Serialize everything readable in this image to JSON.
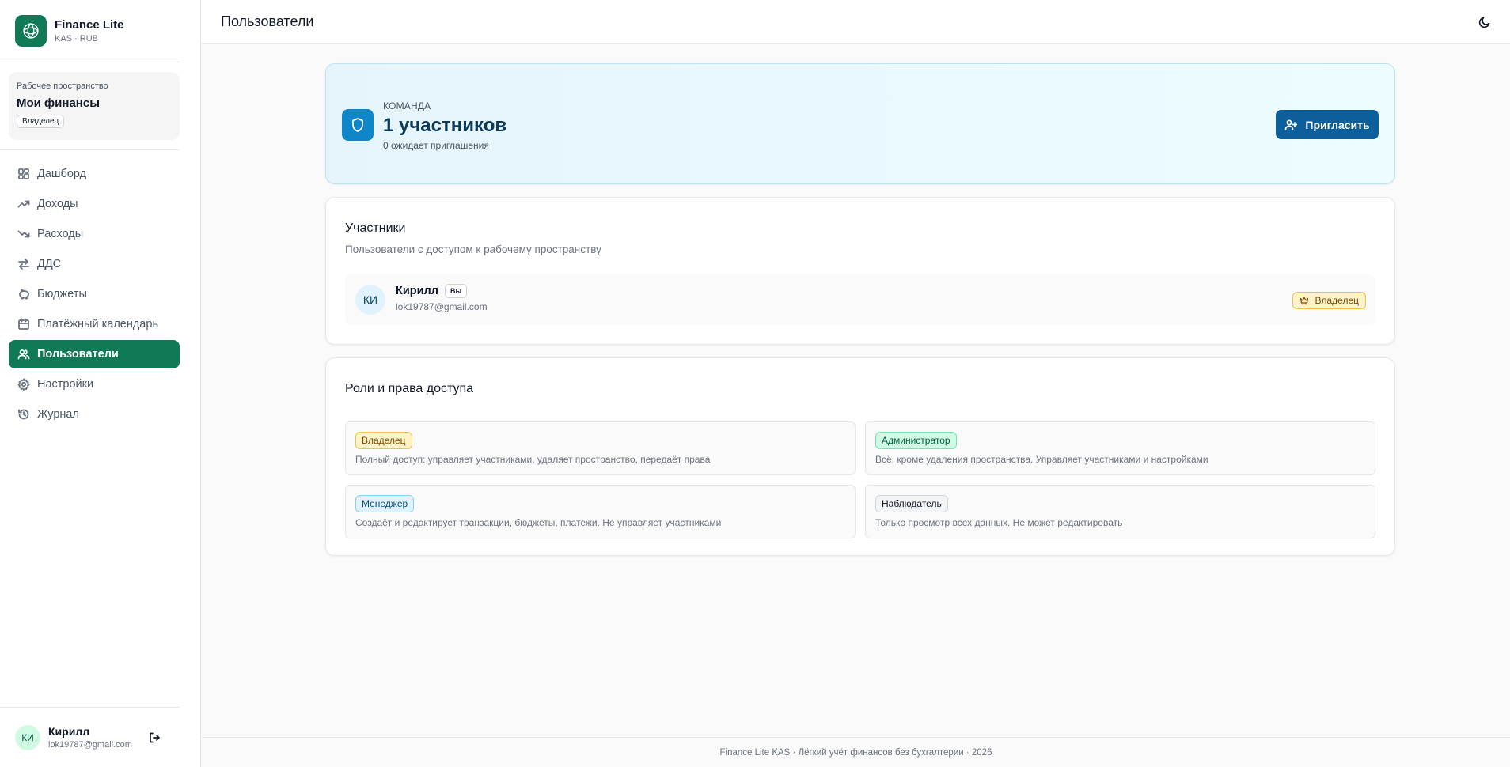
{
  "brand": {
    "name": "Finance Lite",
    "subtitle": "KAS · RUB"
  },
  "workspace": {
    "label": "Рабочее пространство",
    "name": "Мои финансы",
    "role": "Владелец"
  },
  "nav": [
    {
      "label": "Дашборд",
      "icon": "dashboard-icon"
    },
    {
      "label": "Доходы",
      "icon": "trending-up-icon"
    },
    {
      "label": "Расходы",
      "icon": "trending-down-icon"
    },
    {
      "label": "ДДС",
      "icon": "arrows-exchange-icon"
    },
    {
      "label": "Бюджеты",
      "icon": "piggy-bank-icon"
    },
    {
      "label": "Платёжный календарь",
      "icon": "calendar-icon"
    },
    {
      "label": "Пользователи",
      "icon": "users-icon",
      "active": true
    },
    {
      "label": "Настройки",
      "icon": "gear-icon"
    },
    {
      "label": "Журнал",
      "icon": "history-icon"
    }
  ],
  "current_user": {
    "initials": "КИ",
    "name": "Кирилл",
    "email": "lok19787@gmail.com"
  },
  "header": {
    "title": "Пользователи"
  },
  "team": {
    "label": "КОМАНДА",
    "count": "1 участников",
    "pending": "0 ожидает приглашения",
    "invite_label": "Пригласить"
  },
  "members": {
    "title": "Участники",
    "subtitle": "Пользователи с доступом к рабочему пространству",
    "items": [
      {
        "initials": "КИ",
        "name": "Кирилл",
        "you_label": "Вы",
        "email": "lok19787@gmail.com",
        "role": "Владелец"
      }
    ]
  },
  "roles": {
    "title": "Роли и права доступа",
    "items": [
      {
        "name": "Владелец",
        "description": "Полный доступ: управляет участниками, удаляет пространство, передаёт права",
        "color": "#fef3c7"
      },
      {
        "name": "Администратор",
        "description": "Всё, кроме удаления пространства. Управляет участниками и настройками",
        "color": "#d1fae5"
      },
      {
        "name": "Менеджер",
        "description": "Создаёт и редактирует транзакции, бюджеты, платежи. Не управляет участниками",
        "color": "#e0f2fe"
      },
      {
        "name": "Наблюдатель",
        "description": "Только просмотр всех данных. Не может редактировать",
        "color": "#f3f4f6"
      }
    ]
  },
  "footer": {
    "text": "Finance Lite KAS · Лёгкий учёт финансов без бухгалтерии · 2026"
  },
  "colors": {
    "brand": "#0f7a55",
    "primary": "#0c5f9a",
    "accent": "#0e86c8"
  }
}
